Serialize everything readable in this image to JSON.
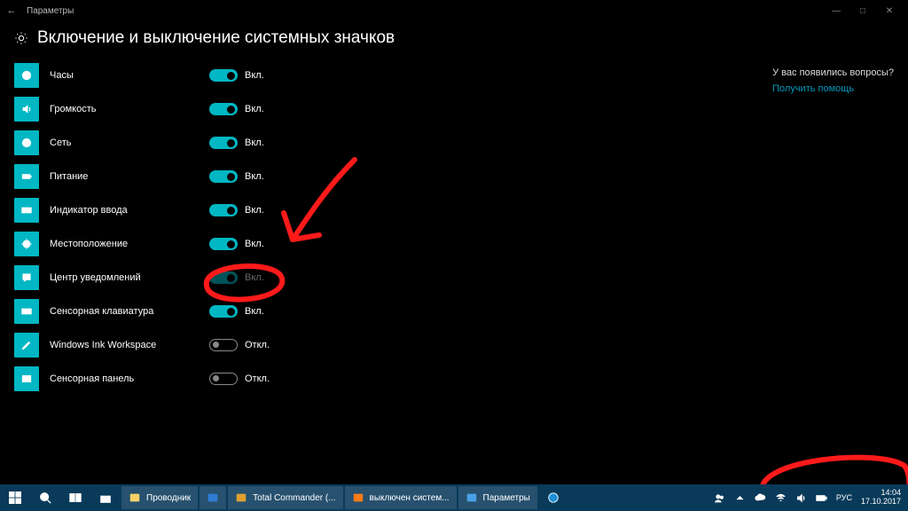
{
  "window": {
    "title": "Параметры"
  },
  "page": {
    "title": "Включение и выключение системных значков"
  },
  "states": {
    "on": "Вкл.",
    "off": "Откл."
  },
  "items": [
    {
      "key": "clock",
      "label": "Часы",
      "icon": "clock",
      "state": "on",
      "disabled": false
    },
    {
      "key": "volume",
      "label": "Громкость",
      "icon": "volume",
      "state": "on",
      "disabled": false
    },
    {
      "key": "network",
      "label": "Сеть",
      "icon": "globe",
      "state": "on",
      "disabled": false
    },
    {
      "key": "power",
      "label": "Питание",
      "icon": "power",
      "state": "on",
      "disabled": false
    },
    {
      "key": "input",
      "label": "Индикатор ввода",
      "icon": "keyboard",
      "state": "on",
      "disabled": false
    },
    {
      "key": "location",
      "label": "Местоположение",
      "icon": "location",
      "state": "on",
      "disabled": false
    },
    {
      "key": "action",
      "label": "Центр уведомлений",
      "icon": "action",
      "state": "on",
      "disabled": true
    },
    {
      "key": "touchkbd",
      "label": "Сенсорная клавиатура",
      "icon": "keyboard",
      "state": "on",
      "disabled": false
    },
    {
      "key": "ink",
      "label": "Windows Ink Workspace",
      "icon": "pen",
      "state": "off",
      "disabled": false
    },
    {
      "key": "touchpad",
      "label": "Сенсорная панель",
      "icon": "touchpad",
      "state": "off",
      "disabled": false
    }
  ],
  "help": {
    "question": "У вас появились вопросы?",
    "link": "Получить помощь"
  },
  "taskbar": {
    "tasks": [
      {
        "label": "Проводник",
        "icon": "folder",
        "color": "#f8d267"
      },
      {
        "label": "",
        "icon": "mail",
        "color": "#2e7cd6"
      },
      {
        "label": "Total Commander (...",
        "icon": "tc",
        "color": "#e0a030"
      },
      {
        "label": "выключен систем...",
        "icon": "firefox",
        "color": "#ff7b1a"
      },
      {
        "label": "Параметры",
        "icon": "settings",
        "color": "#4aa0e6"
      }
    ],
    "edge": true,
    "lang": "РУС",
    "time": "14:04",
    "date": "17.10.2017"
  }
}
